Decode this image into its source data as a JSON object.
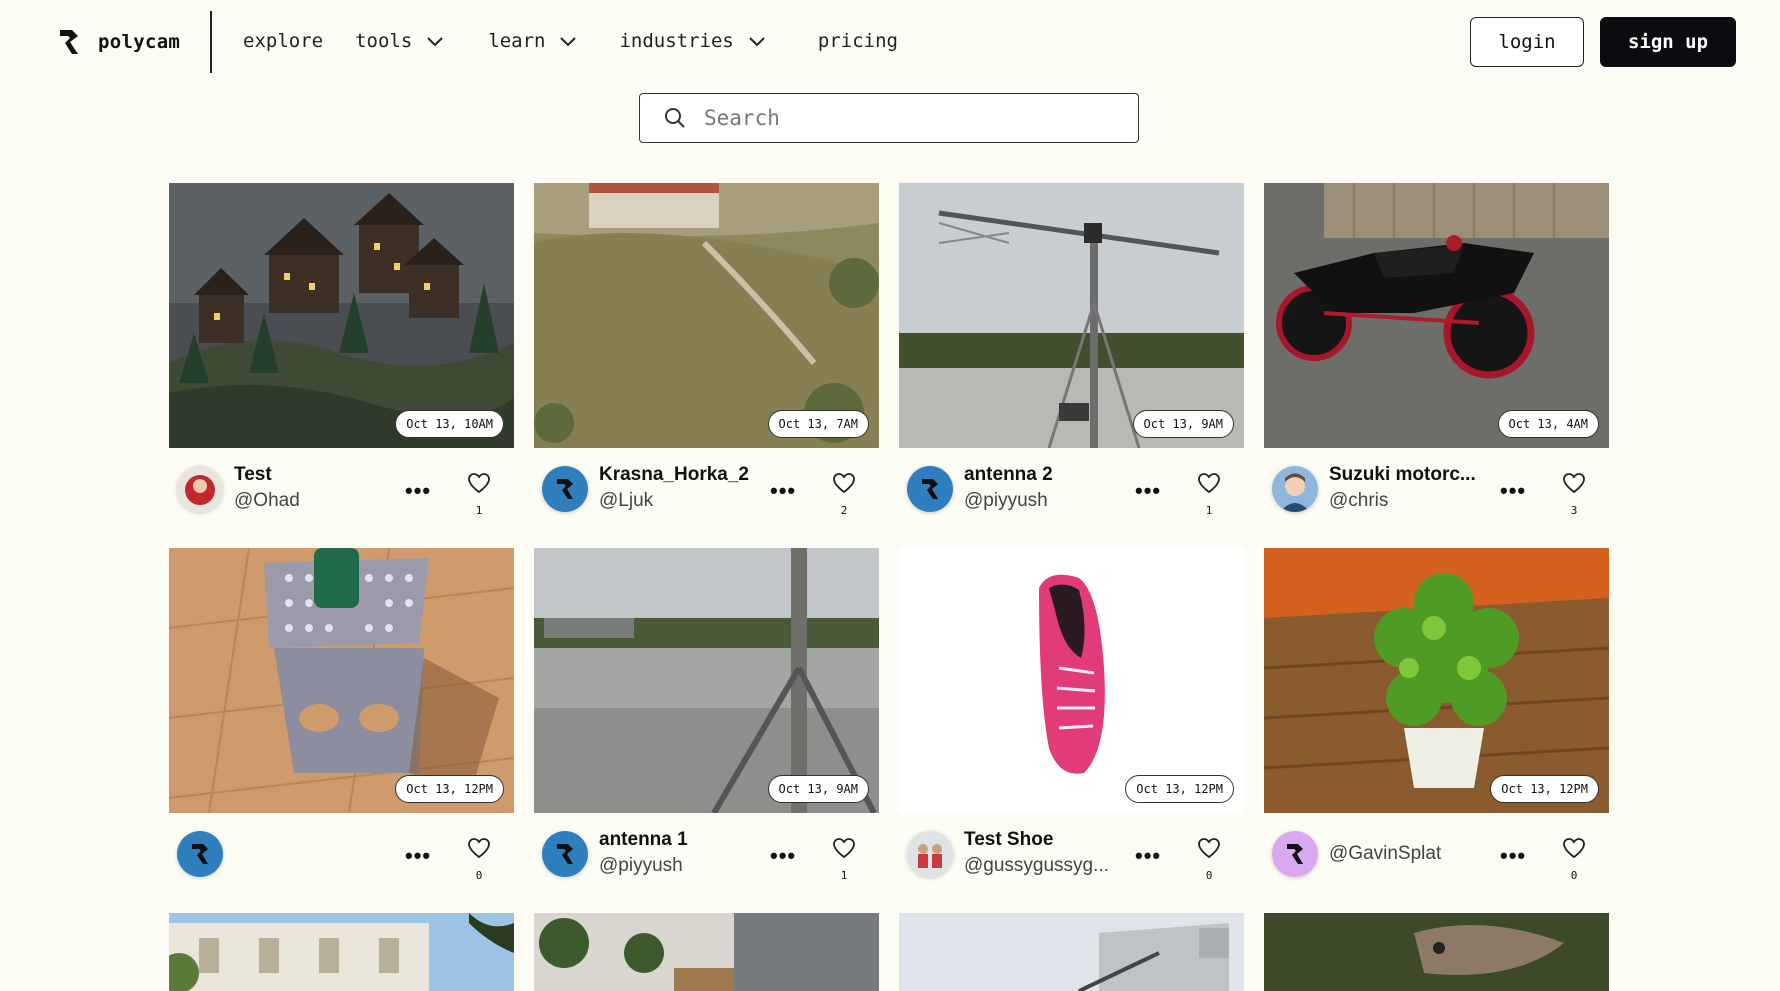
{
  "header": {
    "brand": "polycam",
    "nav": [
      {
        "label": "explore"
      },
      {
        "label": "tools"
      },
      {
        "label": "learn"
      },
      {
        "label": "industries"
      },
      {
        "label": "pricing"
      }
    ],
    "login_label": "login",
    "signup_label": "sign up"
  },
  "search": {
    "placeholder": "Search"
  },
  "cards": [
    {
      "date": "Oct 13, 10AM",
      "title": "Test",
      "handle": "@Ohad",
      "likes": "1"
    },
    {
      "date": "Oct 13, 7AM",
      "title": "Krasna_Horka_2",
      "handle": "@Ljuk",
      "likes": "2"
    },
    {
      "date": "Oct 13, 9AM",
      "title": "antenna 2",
      "handle": "@piyyush",
      "likes": "1"
    },
    {
      "date": "Oct 13, 4AM",
      "title": "Suzuki motorc...",
      "handle": "@chris",
      "likes": "3"
    },
    {
      "date": "Oct 13, 12PM",
      "title": "",
      "handle": "",
      "likes": "0"
    },
    {
      "date": "Oct 13, 9AM",
      "title": "antenna 1",
      "handle": "@piyyush",
      "likes": "1"
    },
    {
      "date": "Oct 13, 12PM",
      "title": "Test Shoe",
      "handle": "@gussygussyg...",
      "likes": "0"
    },
    {
      "date": "Oct 13, 12PM",
      "title": "",
      "handle": "@GavinSplat",
      "likes": "0"
    }
  ],
  "more_glyph": "•••",
  "colors": {
    "background": "#fcfcf4",
    "accent_dark": "#0c0c10",
    "avatar_blue": "#2f7fbf"
  }
}
